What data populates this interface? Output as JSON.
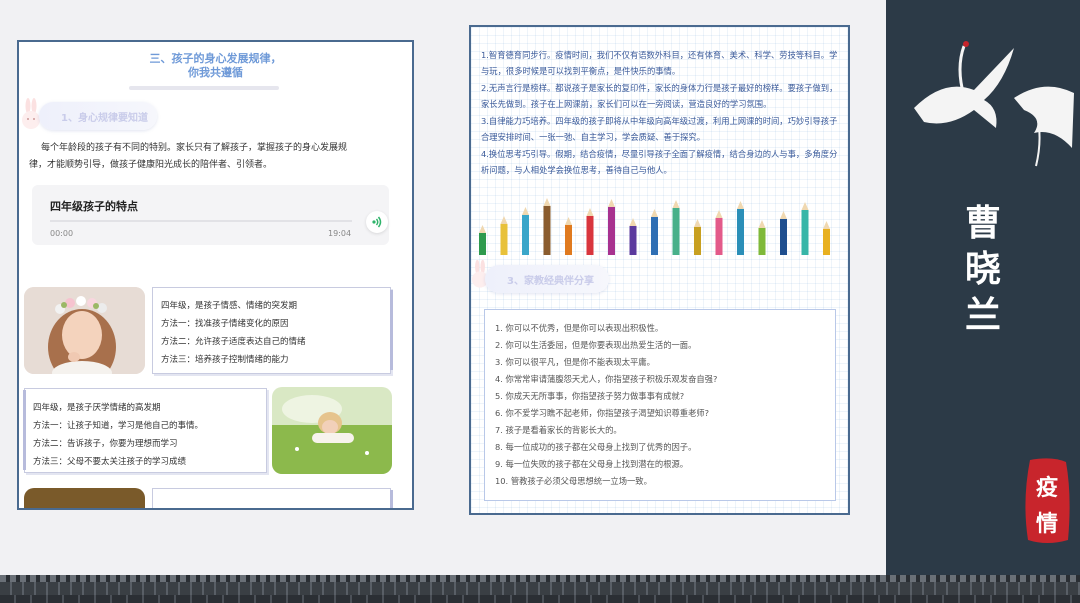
{
  "left": {
    "title_line1": "三、孩子的身心发展规律，",
    "title_line2": "你我共遵循",
    "section1": "1、身心规律要知道",
    "intro_line1": "每个年龄段的孩子有不同的特别。家长只有了解孩子，掌握孩子的身心发展规",
    "intro_line2": "律，才能顺势引导，做孩子健康阳光成长的陪伴者、引领者。",
    "audio": {
      "title": "四年级孩子的特点",
      "start": "00:00",
      "end": "19:04"
    },
    "box1": [
      "四年级，是孩子情感、情绪的突发期",
      "方法一：找准孩子情绪变化的原因",
      "方法二：允许孩子适度表达自己的情绪",
      "方法三：培养孩子控制情绪的能力"
    ],
    "box2": [
      "四年级，是孩子厌学情绪的高发期",
      "方法一：让孩子知道，学习是他自己的事情。",
      "方法二：告诉孩子，你要为理想而学习",
      "方法三：父母不要太关注孩子的学习成绩"
    ]
  },
  "middle": {
    "tips": [
      "1.智育德育同步行。疫情时间，我们不仅有语数外科目，还有体育、美术、科学、劳技等科目。学与玩，很多时候是可以找到平衡点，是件快乐的事情。",
      "2.无声言行是榜样。都说孩子是家长的复印件，家长的身体力行是孩子最好的榜样。要孩子做到，家长先做到。孩子在上网课前，家长们可以在一旁阅读，营造良好的学习氛围。",
      "3.自律能力巧培养。四年级的孩子即将从中年级向高年级过渡，利用上网课的时间，巧妙引导孩子合理安排时间、一张一弛、自主学习，学会质疑、善于探究。",
      "4.换位思考巧引导。假期，结合疫情，尽量引导孩子全面了解疫情，结合身边的人与事，多角度分析问题，与人相处学会换位思考，善待自己与他人。"
    ],
    "section3": "3、家教经典伴分享",
    "quotes": [
      "1. 你可以不优秀，但是你可以表现出积极性。",
      "2. 你可以生活委屈，但是你要表现出热爱生活的一面。",
      "3. 你可以很平凡，但是你不能表现太平庸。",
      "4. 你常常审请蒲腹怨天尤人，你指望孩子积极乐观发奋自强?",
      "5. 你成天无所事事，你指望孩子努力做事事有成就?",
      "6. 你不爱学习瞧不起老师，你指望孩子渴望知识尊重老师?",
      "7. 孩子是看着家长的背影长大的。",
      "8. 每一位成功的孩子都在父母身上找到了优秀的因子。",
      "9. 每一位失败的孩子都在父母身上找到潜在的根源。",
      "10. 管教孩子必须父母思想统一立场一致。"
    ]
  },
  "right": {
    "name_chars": [
      "曹",
      "晓",
      "兰"
    ],
    "seal_chars": [
      "疫",
      "情"
    ]
  },
  "colors": {
    "accent_blue": "#6f9ad8",
    "panel_border": "#4a6a8f",
    "dark_panel": "#2c3a47",
    "seal_red": "#c8252c",
    "tip_text": "#3a5a9a"
  }
}
